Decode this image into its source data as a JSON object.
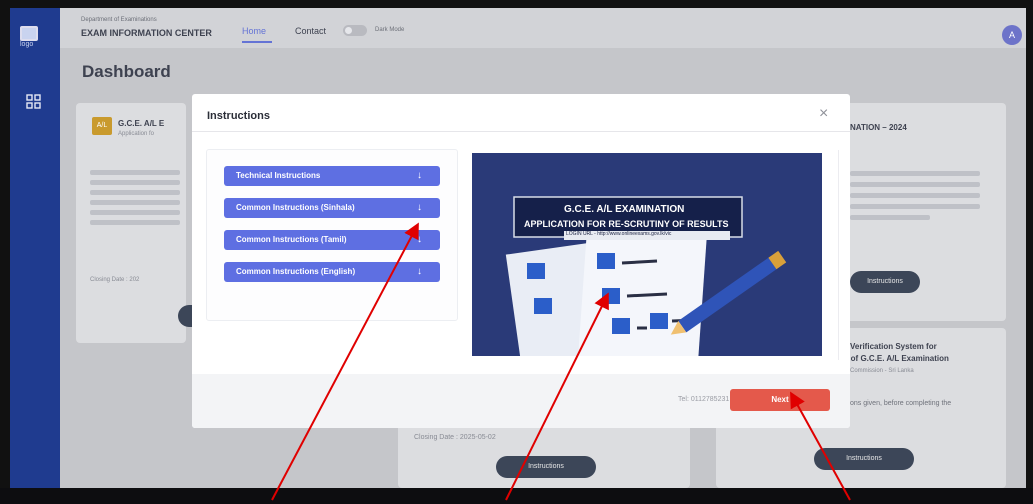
{
  "sidebar": {
    "logo_text": "logo"
  },
  "header": {
    "dept": "Department of Examinations",
    "center": "EXAM INFORMATION CENTER",
    "nav_home": "Home",
    "nav_contact": "Contact",
    "dark_mode": "Dark Mode",
    "avatar": "A"
  },
  "page_title": "Dashboard",
  "cards": {
    "card1_title": "G.C.E. A/L E",
    "card1_sub": "Application fo",
    "card1_badge": "A/L",
    "card1_closing": "Closing Date : 202",
    "card3_title": "NATION – 2024",
    "card3_sub": "...",
    "card3_btn": "Instructions",
    "card4_title1": "Verification System for",
    "card4_title2": "s of G.C.E. A/L Examination",
    "card4_sub": "Commission - Sri Lanka",
    "card4_text": "ons given, before completing the",
    "card4_btn": "Instructions",
    "card2_closing": "Closing Date : 2025-05-02",
    "card2_btn": "Instructions"
  },
  "modal": {
    "title": "Instructions",
    "close": "×",
    "accordions": [
      "Technical Instructions",
      "Common Instructions (Sinhala)",
      "Common Instructions (Tamil)",
      "Common Instructions (English)"
    ],
    "arrow": "↓",
    "image": {
      "line1": "G.C.E. A/L EXAMINATION",
      "line2": "APPLICATION FOR RE-SCRUTINY OF RESULTS",
      "login": "LOGIN URL - http://www.onlineexams.gov.lk/vic"
    },
    "tel": "Tel: 0112785231",
    "next": "Next"
  },
  "colors": {
    "accent": "#5e6fe2",
    "next": "#e4594b",
    "sidebar": "#1f3b8f"
  }
}
